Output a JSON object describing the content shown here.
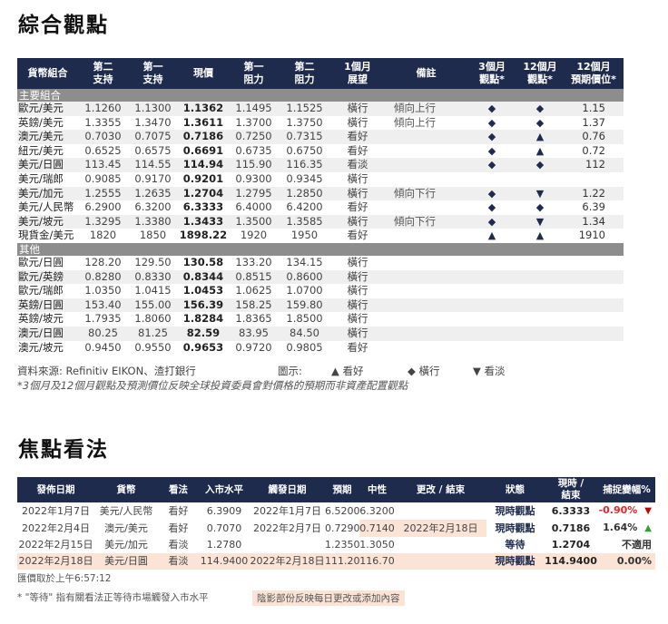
{
  "section1": {
    "title": "綜合觀點",
    "headers": [
      "貨幣組合",
      "第二\n支持",
      "第一\n支持",
      "現價",
      "第一\n阻力",
      "第二\n阻力",
      "1個月\n展望",
      "備註",
      "3個月\n觀點*",
      "12個月\n觀點*",
      "12個月\n預期價位*"
    ],
    "groups": [
      {
        "name": "主要組合",
        "rows": [
          {
            "pair": "歐元/美元",
            "s2": "1.1260",
            "s1": "1.1300",
            "spot": "1.1362",
            "r1": "1.1495",
            "r2": "1.1525",
            "outlook": "橫行",
            "tone": "neut",
            "note": "傾向上行",
            "m3": "◆",
            "m12": "◆",
            "target": "1.15"
          },
          {
            "pair": "英鎊/美元",
            "s2": "1.3355",
            "s1": "1.3470",
            "spot": "1.3611",
            "r1": "1.3700",
            "r2": "1.3750",
            "outlook": "橫行",
            "tone": "neut",
            "note": "傾向上行",
            "m3": "◆",
            "m12": "◆",
            "target": "1.37"
          },
          {
            "pair": "澳元/美元",
            "s2": "0.7030",
            "s1": "0.7075",
            "spot": "0.7186",
            "r1": "0.7250",
            "r2": "0.7315",
            "outlook": "看好",
            "tone": "bull",
            "note": "",
            "m3": "◆",
            "m12": "▲",
            "target": "0.76"
          },
          {
            "pair": "紐元/美元",
            "s2": "0.6525",
            "s1": "0.6575",
            "spot": "0.6691",
            "r1": "0.6735",
            "r2": "0.6750",
            "outlook": "看好",
            "tone": "bull",
            "note": "",
            "m3": "◆",
            "m12": "▲",
            "target": "0.72"
          },
          {
            "pair": "美元/日圓",
            "s2": "113.45",
            "s1": "114.55",
            "spot": "114.94",
            "r1": "115.90",
            "r2": "116.35",
            "outlook": "看淡",
            "tone": "bear",
            "note": "",
            "m3": "◆",
            "m12": "◆",
            "target": "112"
          },
          {
            "pair": "美元/瑞郎",
            "s2": "0.9085",
            "s1": "0.9170",
            "spot": "0.9201",
            "r1": "0.9300",
            "r2": "0.9345",
            "outlook": "橫行",
            "tone": "neut",
            "note": "",
            "m3": "",
            "m12": "",
            "target": ""
          },
          {
            "pair": "美元/加元",
            "s2": "1.2555",
            "s1": "1.2635",
            "spot": "1.2704",
            "r1": "1.2795",
            "r2": "1.2850",
            "outlook": "橫行",
            "tone": "neut",
            "note": "傾向下行",
            "m3": "◆",
            "m12": "▼",
            "target": "1.22"
          },
          {
            "pair": "美元/人民幣",
            "s2": "6.2900",
            "s1": "6.3200",
            "spot": "6.3333",
            "r1": "6.4000",
            "r2": "6.4200",
            "outlook": "看好",
            "tone": "bull",
            "note": "",
            "m3": "◆",
            "m12": "◆",
            "target": "6.39"
          },
          {
            "pair": "美元/坡元",
            "s2": "1.3295",
            "s1": "1.3380",
            "spot": "1.3433",
            "r1": "1.3500",
            "r2": "1.3585",
            "outlook": "橫行",
            "tone": "neut",
            "note": "傾向下行",
            "m3": "◆",
            "m12": "▼",
            "target": "1.34"
          },
          {
            "pair": "現貨金/美元",
            "s2": "1820",
            "s1": "1850",
            "spot": "1898.22",
            "r1": "1920",
            "r2": "1950",
            "outlook": "看好",
            "tone": "bull",
            "note": "",
            "m3": "▲",
            "m12": "▲",
            "target": "1910"
          }
        ]
      },
      {
        "name": "其他",
        "rows": [
          {
            "pair": "歐元/日圓",
            "s2": "128.20",
            "s1": "129.50",
            "spot": "130.58",
            "r1": "133.20",
            "r2": "134.15",
            "outlook": "橫行",
            "tone": "neut",
            "note": "",
            "m3": "",
            "m12": "",
            "target": ""
          },
          {
            "pair": "歐元/英鎊",
            "s2": "0.8280",
            "s1": "0.8330",
            "spot": "0.8344",
            "r1": "0.8515",
            "r2": "0.8600",
            "outlook": "橫行",
            "tone": "neut",
            "note": "",
            "m3": "",
            "m12": "",
            "target": ""
          },
          {
            "pair": "歐元/瑞郎",
            "s2": "1.0350",
            "s1": "1.0415",
            "spot": "1.0453",
            "r1": "1.0625",
            "r2": "1.0700",
            "outlook": "橫行",
            "tone": "neut",
            "note": "",
            "m3": "",
            "m12": "",
            "target": ""
          },
          {
            "pair": "英鎊/日圓",
            "s2": "153.40",
            "s1": "155.00",
            "spot": "156.39",
            "r1": "158.25",
            "r2": "159.80",
            "outlook": "橫行",
            "tone": "neut",
            "note": "",
            "m3": "",
            "m12": "",
            "target": ""
          },
          {
            "pair": "英鎊/坡元",
            "s2": "1.7935",
            "s1": "1.8060",
            "spot": "1.8284",
            "r1": "1.8365",
            "r2": "1.8500",
            "outlook": "橫行",
            "tone": "neut",
            "note": "",
            "m3": "",
            "m12": "",
            "target": ""
          },
          {
            "pair": "澳元/日圓",
            "s2": "80.25",
            "s1": "81.25",
            "spot": "82.59",
            "r1": "83.95",
            "r2": "84.50",
            "outlook": "橫行",
            "tone": "neut",
            "note": "",
            "m3": "",
            "m12": "",
            "target": ""
          },
          {
            "pair": "澳元/坡元",
            "s2": "0.9450",
            "s1": "0.9550",
            "spot": "0.9653",
            "r1": "0.9720",
            "r2": "0.9805",
            "outlook": "看好",
            "tone": "bull",
            "note": "",
            "m3": "",
            "m12": "",
            "target": ""
          }
        ]
      }
    ],
    "source": "資料來源: Refinitiv EIKON、渣打銀行",
    "legend_label": "圖示:",
    "legend_bull": "▲ 看好",
    "legend_neutral": "◆ 橫行",
    "legend_bear": "▼ 看淡",
    "footnote": "*3個月及12個月觀點及預測價位反映全球投資委員會對價格的預期而非資產配置觀點"
  },
  "section2": {
    "title": "焦點看法",
    "headers": [
      "發佈日期",
      "貨幣",
      "看法",
      "入市水平",
      "觸發日期",
      "預期",
      "中性",
      "更改 / 結束",
      "狀態",
      "現時 /\n結束",
      "捕捉變幅%"
    ],
    "rows": [
      {
        "date": "2022年1月7日",
        "pair": "美元/人民幣",
        "view": "看好",
        "tone": "bull",
        "entry": "6.3909",
        "trigger": "2022年1月7日",
        "target": "6.5200",
        "neutral": "6.3200",
        "change": "",
        "status": "現時觀點",
        "current": "6.3333",
        "move": "-0.90%",
        "sign": "neg",
        "arrow": "▼",
        "hl": false,
        "hl_cells": []
      },
      {
        "date": "2022年2月4日",
        "pair": "澳元/美元",
        "view": "看好",
        "tone": "bull",
        "entry": "0.7070",
        "trigger": "2022年2月7日",
        "target": "0.7290",
        "neutral": "0.7140",
        "change": "2022年2月18日",
        "status": "現時觀點",
        "current": "0.7186",
        "move": "1.64%",
        "sign": "pos",
        "arrow": "▲",
        "hl": false,
        "hl_cells": [
          "neutral",
          "change"
        ]
      },
      {
        "date": "2022年2月15日",
        "pair": "美元/加元",
        "view": "看淡",
        "tone": "bear",
        "entry": "1.2780",
        "trigger": "",
        "target": "1.2350",
        "neutral": "1.3050",
        "change": "",
        "status": "等待",
        "current": "1.2704",
        "move": "不適用",
        "sign": "pos",
        "arrow": "",
        "hl": false,
        "hl_cells": []
      },
      {
        "date": "2022年2月18日",
        "pair": "美元/日圓",
        "view": "看淡",
        "tone": "bear",
        "entry": "114.9400",
        "trigger": "2022年2月18日",
        "target": "111.20",
        "neutral": "116.70",
        "change": "",
        "status": "現時觀點",
        "current": "114.9400",
        "move": "0.00%",
        "sign": "pos",
        "arrow": "",
        "hl": true,
        "hl_cells": []
      }
    ],
    "price_time": "匯價取於上午6:57:12",
    "waiting_note": "* \"等待\" 指有關看法正等待市場觸發入市水平",
    "shade_note": "陰影部份反映每日更改或添加內容"
  }
}
